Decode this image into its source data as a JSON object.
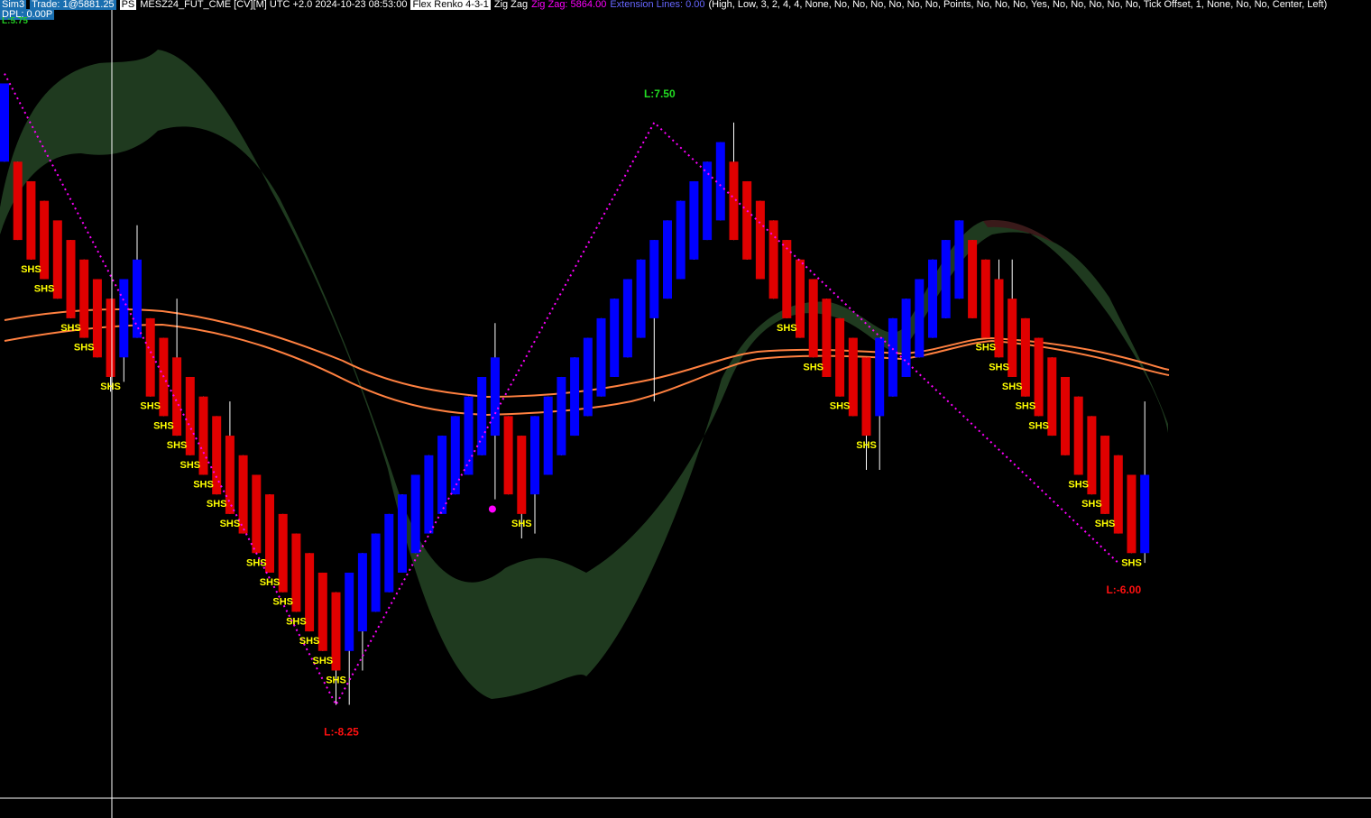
{
  "header": {
    "account": "Sim3",
    "trade": "Trade: 1@5881.25",
    "ps_badge": "PS",
    "instrument": "MESZ24_FUT_CME [CV][M] UTC +2.0 2024-10-23 08:53:00",
    "bar_type": "Flex Renko 4-3-1",
    "indicator": "Zig Zag",
    "zigzag_value": "Zig Zag: 5864.00",
    "extension_lines": "Extension Lines: 0.00",
    "params": "(High, Low, 3, 2, 4, 4, None, No, No, No, No, No, No, Points, No, No, No, Yes, No, No, No, No, No, Tick Offset, 1, None, No, No, Center, Left)"
  },
  "dpl": "DPL: 0.00P",
  "top_left_level": "L:5.75",
  "colors": {
    "background": "#000000",
    "up_brick": "#0000ff",
    "down_brick": "#e00000",
    "zigzag": "#ff00ff",
    "band": "#1f3a1f",
    "band_red": "#3a1a1a",
    "ma": "#ff8040",
    "shs": "#ffff00",
    "label_up": "#22dd22",
    "label_down": "#ff1010",
    "crosshair": "#ffffff"
  },
  "chart_data": {
    "type": "renko",
    "brick_size": 1,
    "bricks": [
      {
        "dir": "up",
        "open": -0.75,
        "close": 3.25,
        "high": 3.25,
        "low": -0.75
      },
      {
        "dir": "down",
        "open": -0.75,
        "close": -4.75,
        "high": -0.75,
        "low": -4.75
      },
      {
        "dir": "down",
        "open": -1.75,
        "close": -5.75,
        "high": -1.75,
        "low": -5.75,
        "label": "SHS"
      },
      {
        "dir": "down",
        "open": -2.75,
        "close": -6.75,
        "high": -2.75,
        "low": -6.75,
        "label": "SHS"
      },
      {
        "dir": "down",
        "open": -3.75,
        "close": -7.75,
        "high": -5.75,
        "low": -7.75
      },
      {
        "dir": "down",
        "open": -4.75,
        "close": -8.75,
        "high": -4.75,
        "low": -8.75,
        "label": "SHS"
      },
      {
        "dir": "down",
        "open": -5.75,
        "close": -9.75,
        "high": -5.75,
        "low": -9.75,
        "label": "SHS"
      },
      {
        "dir": "down",
        "open": -6.75,
        "close": -10.75,
        "high": -6.75,
        "low": -10.75
      },
      {
        "dir": "down",
        "open": -7.75,
        "close": -11.75,
        "high": -7.75,
        "low": -12.5,
        "label": "SHS"
      },
      {
        "dir": "up",
        "open": -10.75,
        "close": -6.75,
        "high": -6.75,
        "low": -12.0
      },
      {
        "dir": "up",
        "open": -9.75,
        "close": -5.75,
        "high": -4.0,
        "low": -9.75
      },
      {
        "dir": "down",
        "open": -8.75,
        "close": -12.75,
        "high": -8.75,
        "low": -12.75,
        "label": "SHS"
      },
      {
        "dir": "down",
        "open": -9.75,
        "close": -13.75,
        "high": -9.75,
        "low": -13.75,
        "label": "SHS"
      },
      {
        "dir": "down",
        "open": -10.75,
        "close": -14.75,
        "high": -7.75,
        "low": -14.75,
        "label": "SHS"
      },
      {
        "dir": "down",
        "open": -11.75,
        "close": -15.75,
        "high": -11.75,
        "low": -15.75,
        "label": "SHS"
      },
      {
        "dir": "down",
        "open": -12.75,
        "close": -16.75,
        "high": -12.75,
        "low": -16.75,
        "label": "SHS"
      },
      {
        "dir": "down",
        "open": -13.75,
        "close": -17.75,
        "high": -13.75,
        "low": -17.75,
        "label": "SHS"
      },
      {
        "dir": "down",
        "open": -14.75,
        "close": -18.75,
        "high": -13.0,
        "low": -18.75,
        "label": "SHS"
      },
      {
        "dir": "down",
        "open": -15.75,
        "close": -19.75,
        "high": -15.75,
        "low": -19.75
      },
      {
        "dir": "down",
        "open": -16.75,
        "close": -20.75,
        "high": -16.75,
        "low": -20.75,
        "label": "SHS"
      },
      {
        "dir": "down",
        "open": -17.75,
        "close": -21.75,
        "high": -17.75,
        "low": -21.75,
        "label": "SHS"
      },
      {
        "dir": "down",
        "open": -18.75,
        "close": -22.75,
        "high": -18.75,
        "low": -22.75,
        "label": "SHS"
      },
      {
        "dir": "down",
        "open": -19.75,
        "close": -23.75,
        "high": -19.75,
        "low": -23.75,
        "label": "SHS"
      },
      {
        "dir": "down",
        "open": -20.75,
        "close": -24.75,
        "high": -20.75,
        "low": -24.75,
        "label": "SHS"
      },
      {
        "dir": "down",
        "open": -21.75,
        "close": -25.75,
        "high": -21.75,
        "low": -25.75,
        "label": "SHS"
      },
      {
        "dir": "down",
        "open": -22.75,
        "close": -26.75,
        "high": -22.75,
        "low": -28.5,
        "label": "SHS"
      },
      {
        "dir": "up",
        "open": -25.75,
        "close": -21.75,
        "high": -21.75,
        "low": -28.5
      },
      {
        "dir": "up",
        "open": -24.75,
        "close": -20.75,
        "high": -20.75,
        "low": -26.75
      },
      {
        "dir": "up",
        "open": -23.75,
        "close": -19.75,
        "high": -19.75,
        "low": -23.75
      },
      {
        "dir": "up",
        "open": -22.75,
        "close": -18.75,
        "high": -18.75,
        "low": -22.75
      },
      {
        "dir": "up",
        "open": -21.75,
        "close": -17.75,
        "high": -17.75,
        "low": -21.75
      },
      {
        "dir": "up",
        "open": -20.75,
        "close": -16.75,
        "high": -16.75,
        "low": -20.75
      },
      {
        "dir": "up",
        "open": -19.75,
        "close": -15.75,
        "high": -15.75,
        "low": -19.75
      },
      {
        "dir": "up",
        "open": -18.75,
        "close": -14.75,
        "high": -14.75,
        "low": -18.75
      },
      {
        "dir": "up",
        "open": -17.75,
        "close": -13.75,
        "high": -13.75,
        "low": -17.75
      },
      {
        "dir": "up",
        "open": -16.75,
        "close": -12.75,
        "high": -12.75,
        "low": -16.75
      },
      {
        "dir": "up",
        "open": -15.75,
        "close": -11.75,
        "high": -11.75,
        "low": -15.75
      },
      {
        "dir": "up",
        "open": -14.75,
        "close": -10.75,
        "high": -9.0,
        "low": -18.0
      },
      {
        "dir": "down",
        "open": -13.75,
        "close": -17.75,
        "high": -13.75,
        "low": -17.75
      },
      {
        "dir": "down",
        "open": -14.75,
        "close": -18.75,
        "high": -14.75,
        "low": -20.0,
        "label": "SHS"
      },
      {
        "dir": "up",
        "open": -17.75,
        "close": -13.75,
        "high": -13.75,
        "low": -19.75
      },
      {
        "dir": "up",
        "open": -16.75,
        "close": -12.75,
        "high": -12.75,
        "low": -16.75
      },
      {
        "dir": "up",
        "open": -15.75,
        "close": -11.75,
        "high": -11.75,
        "low": -15.75
      },
      {
        "dir": "up",
        "open": -14.75,
        "close": -10.75,
        "high": -10.75,
        "low": -14.75
      },
      {
        "dir": "up",
        "open": -13.75,
        "close": -9.75,
        "high": -9.75,
        "low": -13.75
      },
      {
        "dir": "up",
        "open": -12.75,
        "close": -8.75,
        "high": -8.75,
        "low": -12.75
      },
      {
        "dir": "up",
        "open": -11.75,
        "close": -7.75,
        "high": -7.75,
        "low": -11.75
      },
      {
        "dir": "up",
        "open": -10.75,
        "close": -6.75,
        "high": -6.75,
        "low": -10.75
      },
      {
        "dir": "up",
        "open": -9.75,
        "close": -5.75,
        "high": -5.75,
        "low": -9.75
      },
      {
        "dir": "up",
        "open": -8.75,
        "close": -4.75,
        "high": -4.75,
        "low": -13.0
      },
      {
        "dir": "up",
        "open": -7.75,
        "close": -3.75,
        "high": -3.75,
        "low": -7.75
      },
      {
        "dir": "up",
        "open": -6.75,
        "close": -2.75,
        "high": -2.75,
        "low": -6.75
      },
      {
        "dir": "up",
        "open": -5.75,
        "close": -1.75,
        "high": -1.75,
        "low": -5.75
      },
      {
        "dir": "up",
        "open": -4.75,
        "close": -0.75,
        "high": -0.75,
        "low": -4.75
      },
      {
        "dir": "up",
        "open": -3.75,
        "close": 0.25,
        "high": 0.25,
        "low": -3.75
      },
      {
        "dir": "down",
        "open": -0.75,
        "close": -4.75,
        "high": 1.25,
        "low": -4.75
      },
      {
        "dir": "down",
        "open": -1.75,
        "close": -5.75,
        "high": -1.75,
        "low": -5.75
      },
      {
        "dir": "down",
        "open": -2.75,
        "close": -6.75,
        "high": -2.75,
        "low": -6.75
      },
      {
        "dir": "down",
        "open": -3.75,
        "close": -7.75,
        "high": -3.75,
        "low": -7.75
      },
      {
        "dir": "down",
        "open": -4.75,
        "close": -8.75,
        "high": -4.75,
        "low": -8.75,
        "label": "SHS"
      },
      {
        "dir": "down",
        "open": -5.75,
        "close": -9.75,
        "high": -5.75,
        "low": -9.75
      },
      {
        "dir": "down",
        "open": -6.75,
        "close": -10.75,
        "high": -6.75,
        "low": -10.75,
        "label": "SHS"
      },
      {
        "dir": "down",
        "open": -7.75,
        "close": -11.75,
        "high": -7.75,
        "low": -11.75
      },
      {
        "dir": "down",
        "open": -8.75,
        "close": -12.75,
        "high": -8.75,
        "low": -12.75,
        "label": "SHS"
      },
      {
        "dir": "down",
        "open": -9.75,
        "close": -13.75,
        "high": -9.75,
        "low": -13.75
      },
      {
        "dir": "down",
        "open": -10.75,
        "close": -14.75,
        "high": -10.75,
        "low": -16.5,
        "label": "SHS"
      },
      {
        "dir": "up",
        "open": -13.75,
        "close": -9.75,
        "high": -9.75,
        "low": -16.5
      },
      {
        "dir": "up",
        "open": -12.75,
        "close": -8.75,
        "high": -8.75,
        "low": -12.75
      },
      {
        "dir": "up",
        "open": -11.75,
        "close": -7.75,
        "high": -7.75,
        "low": -11.75
      },
      {
        "dir": "up",
        "open": -10.75,
        "close": -6.75,
        "high": -6.75,
        "low": -10.75
      },
      {
        "dir": "up",
        "open": -9.75,
        "close": -5.75,
        "high": -5.75,
        "low": -9.75
      },
      {
        "dir": "up",
        "open": -8.75,
        "close": -4.75,
        "high": -4.75,
        "low": -8.75
      },
      {
        "dir": "up",
        "open": -7.75,
        "close": -3.75,
        "high": -3.75,
        "low": -7.75
      },
      {
        "dir": "down",
        "open": -4.75,
        "close": -8.75,
        "high": -4.75,
        "low": -8.75
      },
      {
        "dir": "down",
        "open": -5.75,
        "close": -9.75,
        "high": -5.75,
        "low": -9.75,
        "label": "SHS"
      },
      {
        "dir": "down",
        "open": -6.75,
        "close": -10.75,
        "high": -5.75,
        "low": -10.75,
        "label": "SHS"
      },
      {
        "dir": "down",
        "open": -7.75,
        "close": -11.75,
        "high": -5.75,
        "low": -11.75,
        "label": "SHS"
      },
      {
        "dir": "down",
        "open": -8.75,
        "close": -12.75,
        "high": -8.75,
        "low": -12.75,
        "label": "SHS"
      },
      {
        "dir": "down",
        "open": -9.75,
        "close": -13.75,
        "high": -9.75,
        "low": -13.75,
        "label": "SHS"
      },
      {
        "dir": "down",
        "open": -10.75,
        "close": -14.75,
        "high": -10.75,
        "low": -14.75
      },
      {
        "dir": "down",
        "open": -11.75,
        "close": -15.75,
        "high": -11.75,
        "low": -15.75
      },
      {
        "dir": "down",
        "open": -12.75,
        "close": -16.75,
        "high": -12.75,
        "low": -16.75,
        "label": "SHS"
      },
      {
        "dir": "down",
        "open": -13.75,
        "close": -17.75,
        "high": -13.75,
        "low": -17.75,
        "label": "SHS"
      },
      {
        "dir": "down",
        "open": -14.75,
        "close": -18.75,
        "high": -14.75,
        "low": -18.75,
        "label": "SHS"
      },
      {
        "dir": "down",
        "open": -15.75,
        "close": -19.75,
        "high": -15.75,
        "low": -19.75
      },
      {
        "dir": "down",
        "open": -16.75,
        "close": -20.75,
        "high": -16.75,
        "low": -20.75,
        "label": "SHS"
      },
      {
        "dir": "up",
        "open": -20.75,
        "close": -16.75,
        "high": -13.0,
        "low": -21.25
      }
    ],
    "zigzag": [
      {
        "i": 0,
        "price": 3.75
      },
      {
        "i": 25,
        "price": -28.5
      },
      {
        "i": 49,
        "price": 1.25
      },
      {
        "i": 84,
        "price": -21.25
      }
    ],
    "zigzag_labels": [
      {
        "i": 25,
        "text": "L:-8.25",
        "dir": "down"
      },
      {
        "i": 49,
        "text": "L:7.50",
        "dir": "up"
      },
      {
        "i": 84,
        "text": "L:-6.00",
        "dir": "down"
      }
    ],
    "marker": {
      "i": 37,
      "price": -18.5
    }
  }
}
